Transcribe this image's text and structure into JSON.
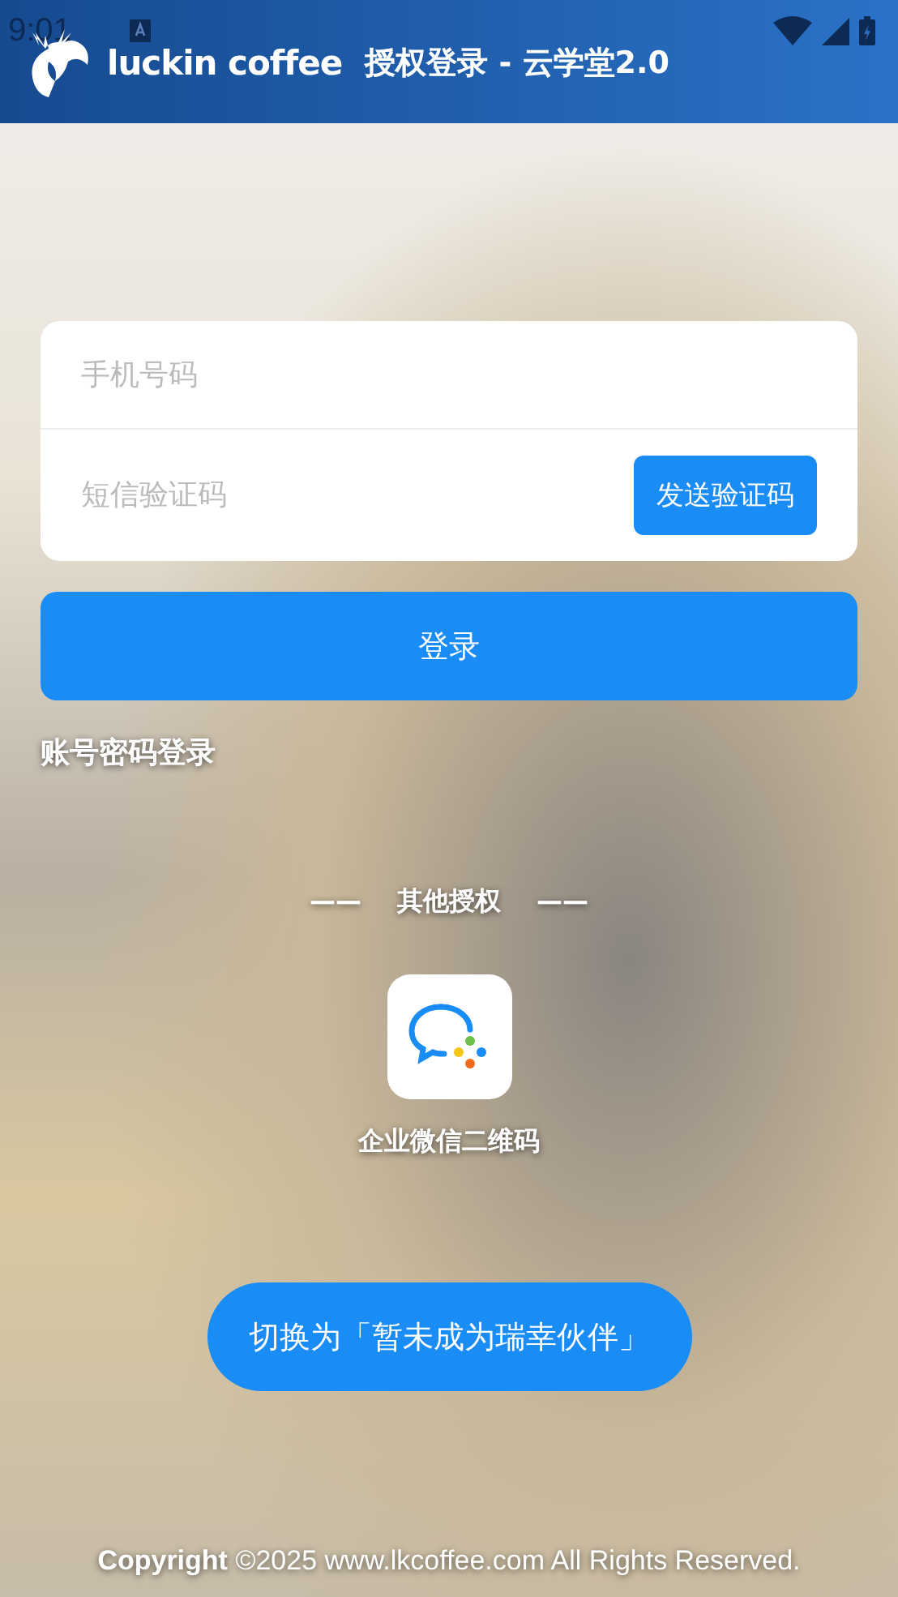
{
  "status_bar": {
    "time": "9:01"
  },
  "header": {
    "brand": "luckin coffee",
    "title": "授权登录 - 云学堂2.0"
  },
  "form": {
    "phone": {
      "placeholder": "手机号码"
    },
    "sms_code": {
      "placeholder": "短信验证码"
    },
    "send_code_button": "发送验证码"
  },
  "login_button": "登录",
  "password_login_link": "账号密码登录",
  "other_auth": {
    "left_dash": "——",
    "title": "其他授权",
    "right_dash": "——",
    "items": [
      {
        "kind": "wecom",
        "label": "企业微信二维码"
      }
    ]
  },
  "switch_button": "切换为「暂未成为瑞幸伙伴」",
  "footer": "**Copyright** ©2025 www.lkcoffee.com All Rights Reserved."
}
